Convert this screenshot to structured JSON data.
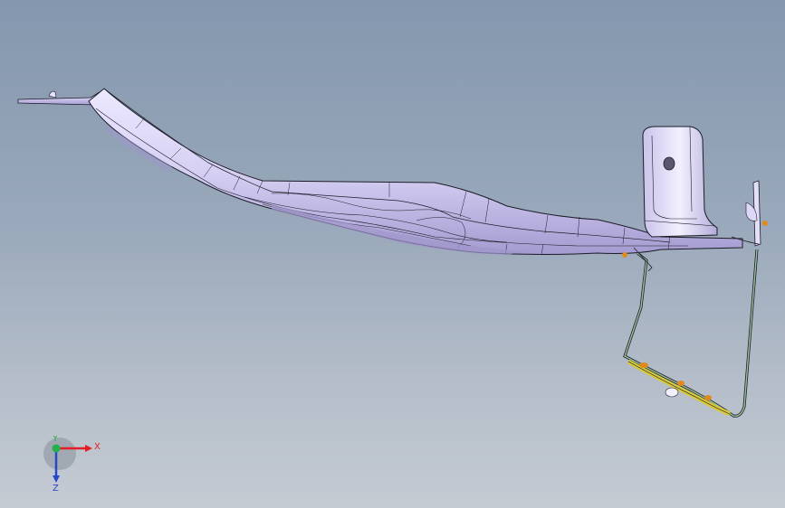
{
  "viewport": {
    "background_top": "#8497ae",
    "background_bottom": "#c5cbd3"
  },
  "part": {
    "body_color": "#d9d4f5",
    "body_shadow": "#a79fd2",
    "edge_color": "#1c1c28",
    "wire_color": "#3f6e3a",
    "yellow_clip": "#d7c93a",
    "orange_feature": "#e08a1c"
  },
  "triad": {
    "x_label": "X",
    "y_label": "Y",
    "z_label": "Z",
    "x_color": "#e31e24",
    "y_color": "#23b14d",
    "z_color": "#2a46c8"
  }
}
